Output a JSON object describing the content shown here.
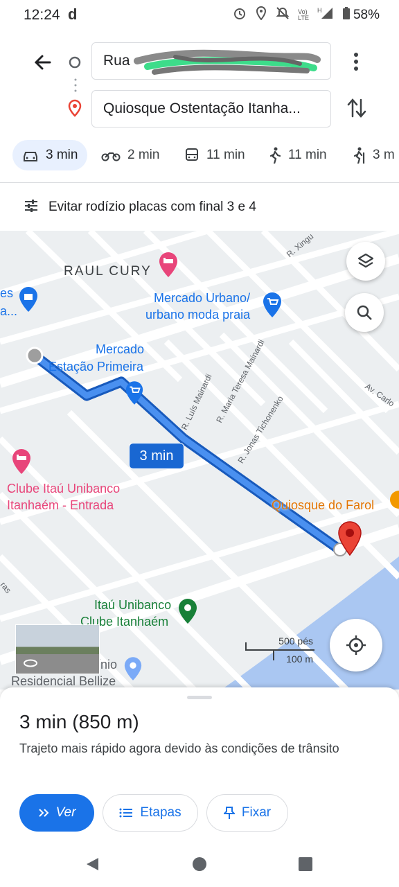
{
  "status_bar": {
    "time": "12:24",
    "carrier_letter": "d",
    "battery": "58%"
  },
  "directions": {
    "origin_value": "Rua",
    "destination_value": "Quiosque Ostentação Itanha..."
  },
  "modes": [
    {
      "label": "3 min",
      "icon": "car-icon",
      "active": true
    },
    {
      "label": "2 min",
      "icon": "motorcycle-icon"
    },
    {
      "label": "11 min",
      "icon": "transit-icon"
    },
    {
      "label": "11 min",
      "icon": "walking-icon"
    },
    {
      "label": "3 m",
      "icon": "hiking-icon"
    }
  ],
  "restriction": {
    "text": "Evitar rodízio placas com final 3 e 4"
  },
  "map": {
    "labels": {
      "raul_cury": "RAUL CURY",
      "mercado_urbano_1": "Mercado Urbano/",
      "mercado_urbano_2": "urbano moda praia",
      "mercado_estacao_1": "Mercado",
      "mercado_estacao_2": "Estação Primeira",
      "clube_itau_1": "Clube Itaú Unibanco",
      "clube_itau_2": "Itanhaém - Entrada",
      "quiosque_farol": "Quiosque do Farol",
      "itau_unibanco_1": "Itaú Unibanco",
      "itau_unibanco_2": "Clube Itanhaém",
      "residencial": "Residencial Bellize",
      "nio": "ínio",
      "es_partial": "es",
      "a_partial": "a...",
      "r_xingu": "R. Xingu",
      "r_luis_mainardi": "R. Luís Mainardi",
      "r_maria_teresa": "R. Maria Teresa Mainardi",
      "r_jonas": "R. Jonas Tichonenko",
      "av_carlos": "Av. Carlo",
      "ras": "ras"
    },
    "route_time": "3 min",
    "scale_imperial": "500 pés",
    "scale_metric": "100 m",
    "colors": {
      "route": "#1a73e8",
      "route_outline": "#185abc",
      "destination_pin": "#ea4335",
      "water": "#aac7f2",
      "map_bg": "#eceff1",
      "poi_pink": "#e8457a",
      "poi_blue": "#1a73e8",
      "poi_green": "#188038"
    }
  },
  "sheet": {
    "summary": "3 min (850 m)",
    "subtitle": "Trajeto mais rápido agora devido às condições de trânsito",
    "buttons": {
      "go": "Ver",
      "steps": "Etapas",
      "pin": "Fixar"
    }
  }
}
